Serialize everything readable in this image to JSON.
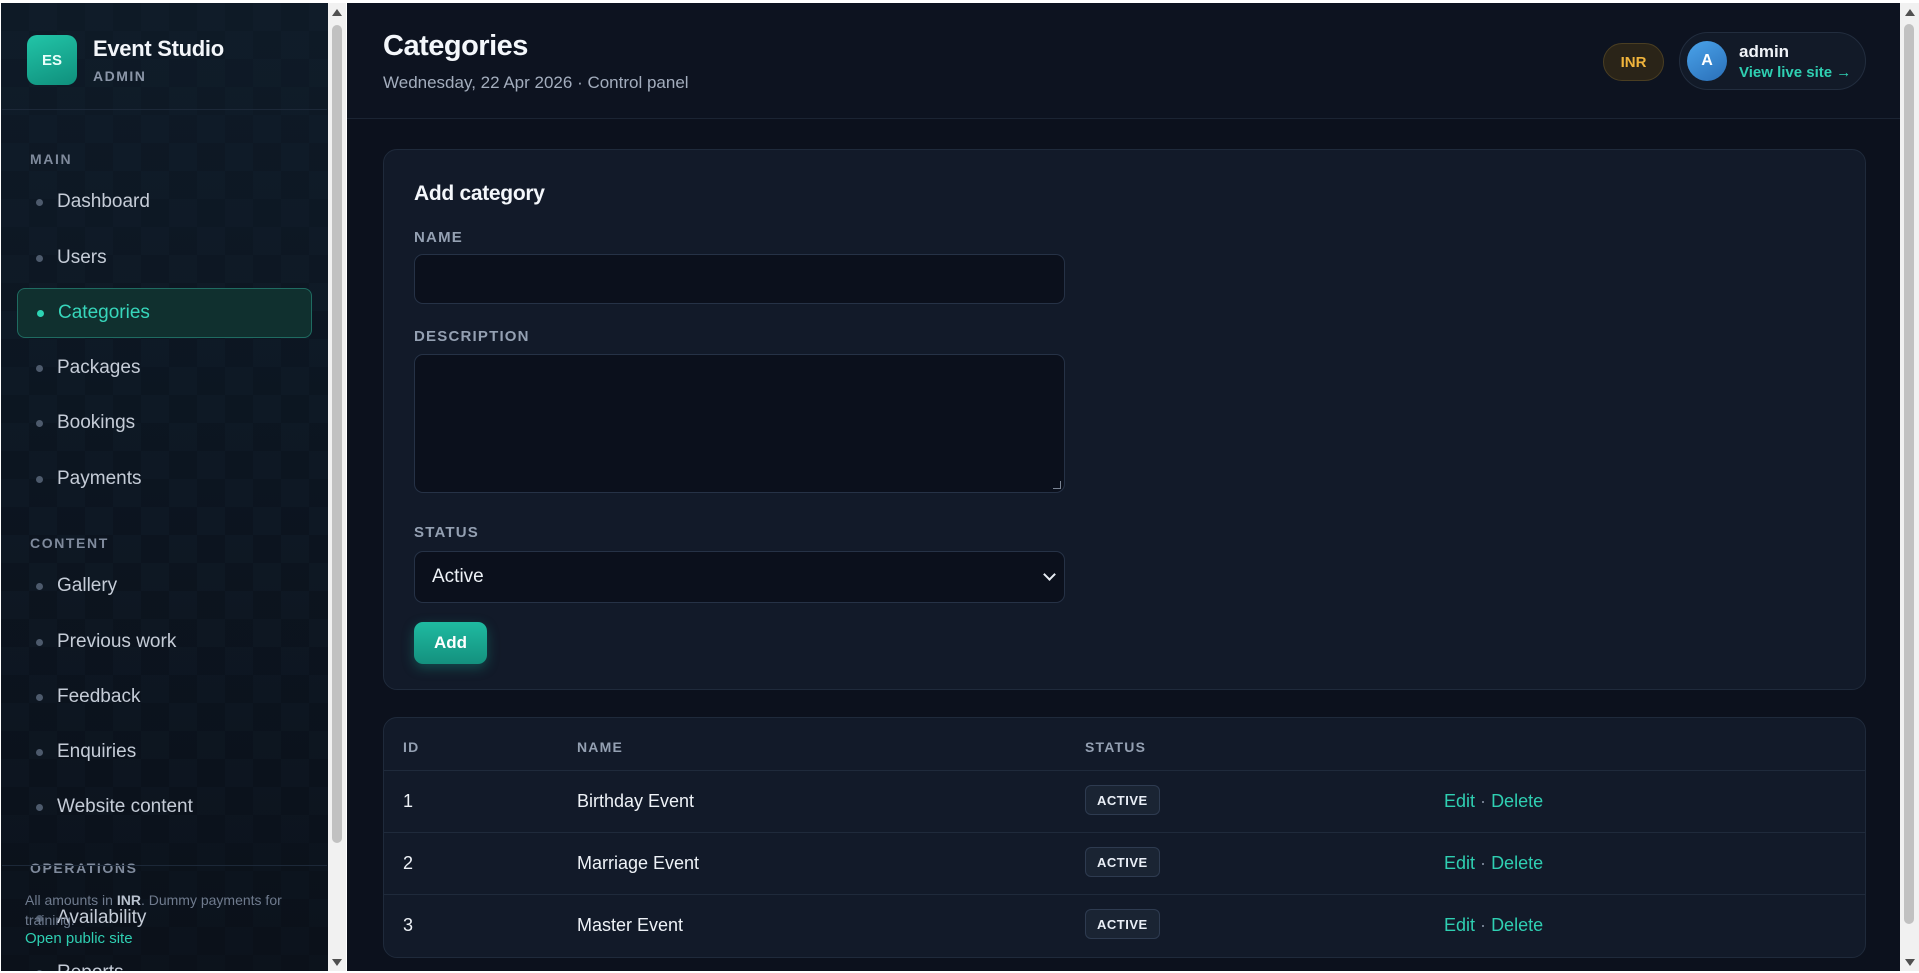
{
  "brand": {
    "logo": "ES",
    "name": "Event Studio",
    "sub": "ADMIN"
  },
  "sidebar": {
    "sections": [
      {
        "label": "MAIN"
      },
      {
        "label": "CONTENT"
      },
      {
        "label": "OPERATIONS"
      }
    ],
    "items": [
      {
        "label": "Dashboard"
      },
      {
        "label": "Users"
      },
      {
        "label": "Categories",
        "active": true
      },
      {
        "label": "Packages"
      },
      {
        "label": "Bookings"
      },
      {
        "label": "Payments"
      },
      {
        "label": "Gallery"
      },
      {
        "label": "Previous work"
      },
      {
        "label": "Feedback"
      },
      {
        "label": "Enquiries"
      },
      {
        "label": "Website content"
      },
      {
        "label": "Availability"
      },
      {
        "label": "Reports"
      }
    ],
    "footer": {
      "note_prefix": "All amounts in ",
      "note_currency": "INR",
      "note_suffix": ". Dummy payments for training.",
      "public_link": "Open public site"
    }
  },
  "header": {
    "title": "Categories",
    "subtitle": "Wednesday, 22 Apr 2026 · Control panel",
    "currency": "INR",
    "user": {
      "avatar": "A",
      "name": "admin",
      "link": "View live site →"
    }
  },
  "form": {
    "title": "Add category",
    "name_label": "NAME",
    "name_value": "",
    "description_label": "DESCRIPTION",
    "description_value": "",
    "status_label": "STATUS",
    "status_value": "Active",
    "submit_label": "Add"
  },
  "table": {
    "columns": [
      "ID",
      "NAME",
      "STATUS"
    ],
    "rows": [
      {
        "id": "1",
        "name": "Birthday Event",
        "status": "ACTIVE"
      },
      {
        "id": "2",
        "name": "Marriage Event",
        "status": "ACTIVE"
      },
      {
        "id": "3",
        "name": "Master Event",
        "status": "ACTIVE"
      }
    ],
    "edit_label": "Edit",
    "separator": "·",
    "delete_label": "Delete"
  },
  "colors": {
    "accent": "#2fcfb2",
    "background": "#0c111d",
    "currency_badge": "#f0b43c"
  }
}
